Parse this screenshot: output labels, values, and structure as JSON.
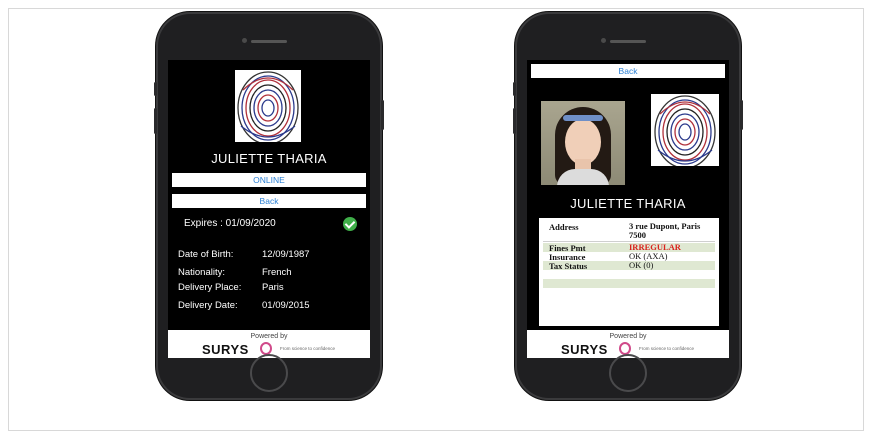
{
  "phone1": {
    "name": "JULIETTE THARIA",
    "status_label": "ONLINE",
    "back_label": "Back",
    "expires": "Expires : 01/09/2020",
    "details": [
      {
        "label": "Date of Birth:",
        "value": "12/09/1987"
      },
      {
        "label": "Nationality:",
        "value": "French"
      },
      {
        "label": "Delivery Place:",
        "value": "Paris"
      },
      {
        "label": "Delivery Date:",
        "value": "01/09/2015"
      }
    ],
    "powered_by": "Powered by",
    "brand": "SURYS",
    "tagline": "From science to confidence"
  },
  "phone2": {
    "back_label": "Back",
    "name": "JULIETTE THARIA",
    "records": [
      {
        "key": "Address",
        "value": "3 rue Dupont, Paris 7500"
      },
      {
        "key": "Fines Pmt",
        "value": "IRREGULAR"
      },
      {
        "key": "Insurance",
        "value": "OK (AXA)"
      },
      {
        "key": "Tax Status",
        "value": "OK (0)"
      }
    ],
    "powered_by": "Powered by",
    "brand": "SURYS",
    "tagline": "From science to confidence"
  },
  "colors": {
    "link_blue": "#2a7fd4",
    "valid_green": "#3fae49",
    "alert_red": "#d9221c",
    "row_tint": "#dfe8d2"
  }
}
